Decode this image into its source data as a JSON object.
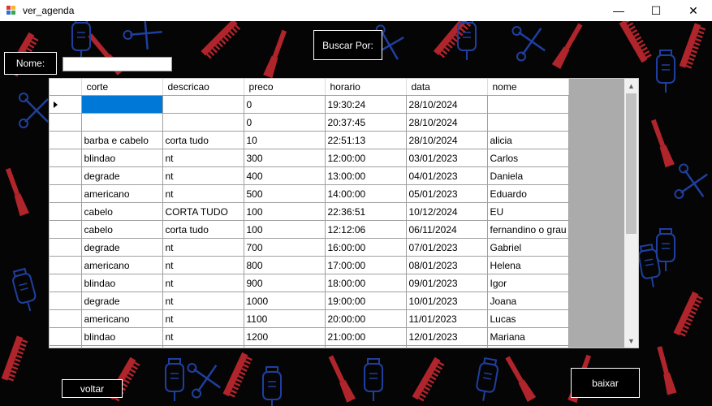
{
  "window": {
    "title": "ver_agenda",
    "minimize": "—",
    "maximize": "☐",
    "close": "✕"
  },
  "toolbar": {
    "search_by_label": "Buscar Por:",
    "name_label": "Nome:",
    "name_value": ""
  },
  "grid": {
    "columns": [
      "corte",
      "descricao",
      "preco",
      "horario",
      "data",
      "nome"
    ],
    "rows": [
      [
        "",
        "",
        "0",
        "19:30:24",
        "28/10/2024",
        ""
      ],
      [
        "",
        "",
        "0",
        "20:37:45",
        "28/10/2024",
        ""
      ],
      [
        "barba e cabelo",
        "corta tudo",
        "10",
        "22:51:13",
        "28/10/2024",
        "alicia"
      ],
      [
        "blindao",
        "nt",
        "300",
        "12:00:00",
        "03/01/2023",
        "Carlos"
      ],
      [
        "degrade",
        "nt",
        "400",
        "13:00:00",
        "04/01/2023",
        "Daniela"
      ],
      [
        "americano",
        "nt",
        "500",
        "14:00:00",
        "05/01/2023",
        "Eduardo"
      ],
      [
        "cabelo",
        "CORTA TUDO",
        "100",
        "22:36:51",
        "10/12/2024",
        "EU"
      ],
      [
        "cabelo",
        "corta tudo",
        "100",
        "12:12:06",
        "06/11/2024",
        "fernandino o grau"
      ],
      [
        "degrade",
        "nt",
        "700",
        "16:00:00",
        "07/01/2023",
        "Gabriel"
      ],
      [
        "americano",
        "nt",
        "800",
        "17:00:00",
        "08/01/2023",
        "Helena"
      ],
      [
        "blindao",
        "nt",
        "900",
        "18:00:00",
        "09/01/2023",
        "Igor"
      ],
      [
        "degrade",
        "nt",
        "1000",
        "19:00:00",
        "10/01/2023",
        "Joana"
      ],
      [
        "americano",
        "nt",
        "1100",
        "20:00:00",
        "11/01/2023",
        "Lucas"
      ],
      [
        "blindao",
        "nt",
        "1200",
        "21:00:00",
        "12/01/2023",
        "Mariana"
      ],
      [
        "",
        "",
        "",
        "",
        "",
        ""
      ]
    ],
    "scroll_up": "▲",
    "scroll_down": "▼"
  },
  "footer": {
    "back_label": "voltar",
    "download_label": "baixar"
  },
  "colors": {
    "selection": "#0078d7",
    "pattern_red": "#b0242b",
    "pattern_blue": "#1f3fa0",
    "background": "#050505"
  },
  "icons": [
    "app-icon",
    "minimize-icon",
    "maximize-icon",
    "close-icon",
    "row-pointer-icon",
    "scroll-up-icon",
    "scroll-down-icon",
    "comb-icon",
    "razor-icon",
    "scissors-icon",
    "clipper-icon"
  ]
}
